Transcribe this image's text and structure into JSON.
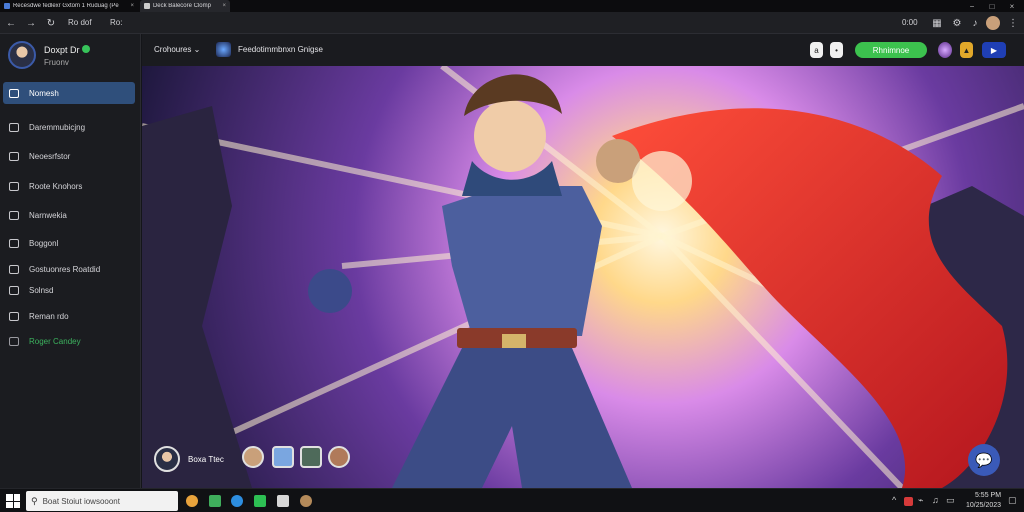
{
  "browser": {
    "tabs": [
      {
        "title": "Recesdwe fedlexr Gxtom 1 Ruduag (Pe"
      },
      {
        "title": "Deck Balecore Clomp"
      }
    ],
    "toolbar": {
      "tab_a": "Ro dof",
      "tab_b": "Ro:",
      "clock": "0:00"
    }
  },
  "sidebar": {
    "user_name": "Doxpt Dr",
    "user_status": "Fruonv",
    "items": [
      {
        "label": "Nomesh",
        "active": true
      },
      {
        "label": "Daremmubicjng"
      },
      {
        "label": "Neoesrfstor"
      },
      {
        "label": "Roote Knohors"
      },
      {
        "label": "Narnwekia"
      },
      {
        "label": "Boggonl"
      },
      {
        "label": "Gostuonres Roatdid"
      },
      {
        "label": "Solnsd"
      },
      {
        "label": "Reman rdo"
      },
      {
        "label": "Roger Candey",
        "green": true
      }
    ]
  },
  "header": {
    "dropdown": "Crohoures",
    "channel": "Feedotimmbnxn Gnigse",
    "cta": "Rhnimnoe",
    "accent": "#3cc24e"
  },
  "hero": {
    "caption": "Boxa Ttec",
    "chat_button_icon": "chat-bubble-icon"
  },
  "taskbar": {
    "search_placeholder": "Boat Stoiut iowsooont",
    "time": "5:55 PM",
    "date": "10/25/2023"
  }
}
